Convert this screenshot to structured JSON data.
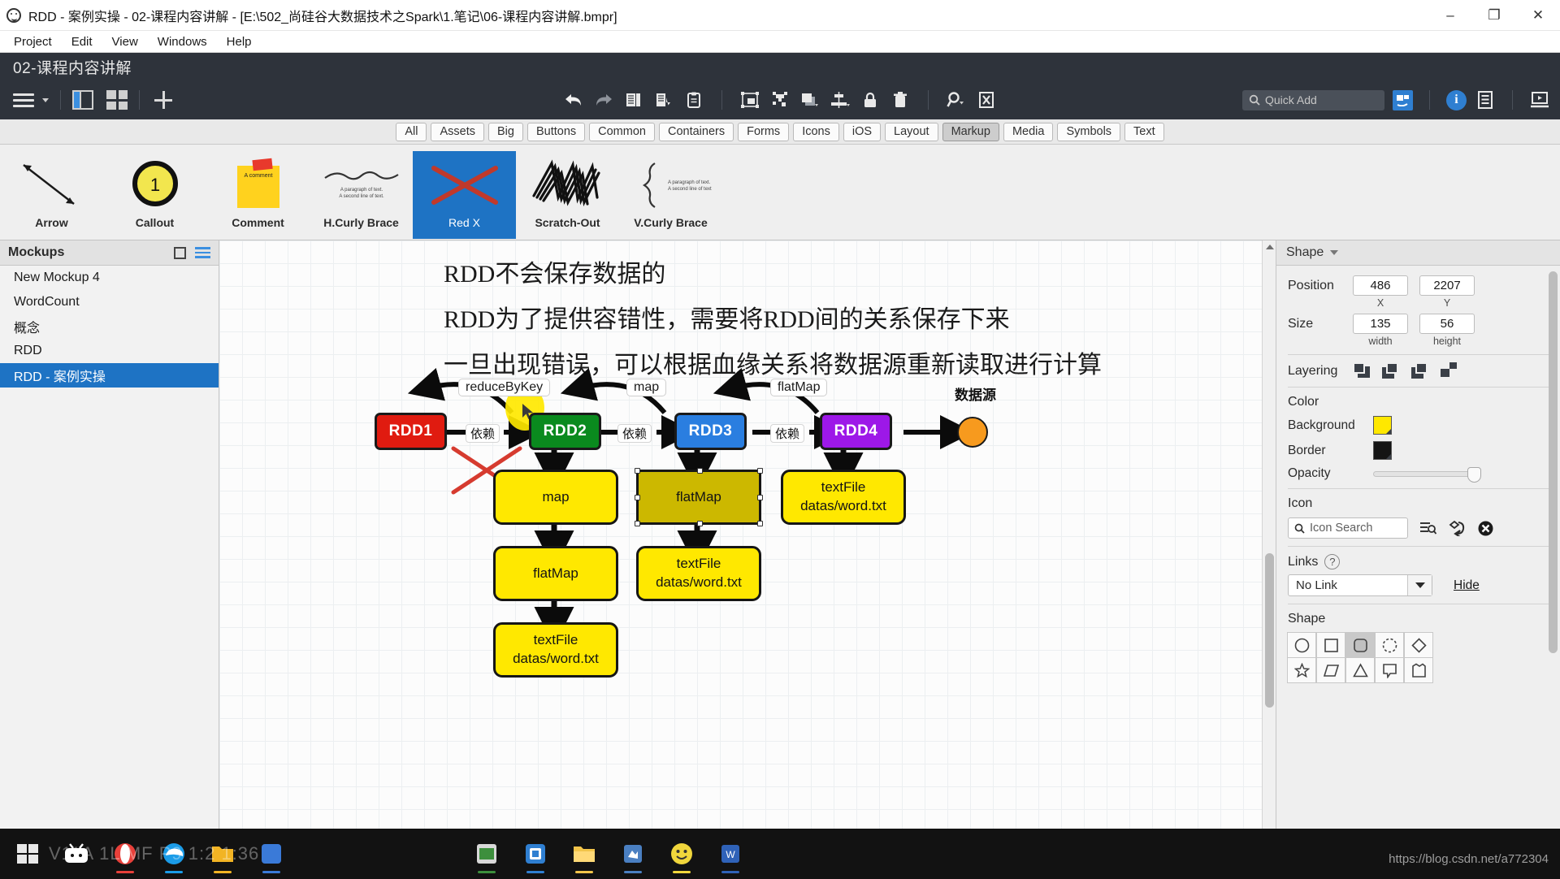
{
  "window": {
    "title": "RDD - 案例实操 - 02-课程内容讲解 - [E:\\502_尚硅谷大数据技术之Spark\\1.笔记\\06-课程内容讲解.bmpr]",
    "minimize": "–",
    "maximize": "❐",
    "close": "✕"
  },
  "menubar": {
    "items": [
      "Project",
      "Edit",
      "View",
      "Windows",
      "Help"
    ]
  },
  "header": {
    "document_name": "02-课程内容讲解"
  },
  "toolbar": {
    "left_icons": [
      "hamburger-menu",
      "panel-toggle",
      "grid-view",
      "add-new"
    ],
    "center_icons": [
      "undo",
      "redo",
      "duplicate",
      "import",
      "paste",
      "group",
      "ungroup",
      "shape-order",
      "align",
      "lock",
      "delete",
      "zoom",
      "fit-to-screen"
    ],
    "quick_add_placeholder": "Quick Add",
    "right_icons": [
      "presentation",
      "info",
      "notes",
      "play"
    ]
  },
  "category_tabs": {
    "items": [
      "All",
      "Assets",
      "Big",
      "Buttons",
      "Common",
      "Containers",
      "Forms",
      "Icons",
      "iOS",
      "Layout",
      "Markup",
      "Media",
      "Symbols",
      "Text"
    ],
    "active": "Markup"
  },
  "stencils": {
    "items": [
      {
        "label": "Arrow",
        "icon": "arrow-diagonal-icon",
        "selected": false
      },
      {
        "label": "Callout",
        "icon": "callout-numbered-icon",
        "selected": false
      },
      {
        "label": "Comment",
        "icon": "sticky-note-icon",
        "selected": false,
        "note_text": "A comment"
      },
      {
        "label": "H.Curly Brace",
        "icon": "horizontal-curly-brace-icon",
        "selected": false,
        "sample_text": "A paragraph of text.\nA second line of text."
      },
      {
        "label": "Red X",
        "icon": "red-x-icon",
        "selected": true
      },
      {
        "label": "Scratch-Out",
        "icon": "scratch-out-icon",
        "selected": false
      },
      {
        "label": "V.Curly Brace",
        "icon": "vertical-curly-brace-icon",
        "selected": false,
        "sample_text": "A paragraph of text.\nA second line of text."
      }
    ]
  },
  "left_panel": {
    "title": "Mockups",
    "header_icons": [
      "new-mockup-icon",
      "list-options-icon"
    ],
    "items": [
      {
        "label": "New Mockup 4",
        "active": false
      },
      {
        "label": "WordCount",
        "active": false
      },
      {
        "label": "概念",
        "active": false
      },
      {
        "label": "RDD",
        "active": false
      },
      {
        "label": "RDD - 案例实操",
        "active": true
      }
    ]
  },
  "canvas": {
    "text_lines": [
      "RDD不会保存数据的",
      "RDD为了提供容错性，需要将RDD间的关系保存下来",
      "一旦出现错误，可以根据血缘关系将数据源重新读取进行计算"
    ],
    "rdd_nodes": [
      {
        "label": "RDD1",
        "color": "#e01b10"
      },
      {
        "label": "RDD2",
        "color": "#0a8a1e"
      },
      {
        "label": "RDD3",
        "color": "#2a7ee0"
      },
      {
        "label": "RDD4",
        "color": "#9d18e8"
      }
    ],
    "dependency_labels": [
      "依赖",
      "依赖",
      "依赖"
    ],
    "operation_labels": [
      "reduceByKey",
      "map",
      "flatMap"
    ],
    "data_source_label": "数据源",
    "columns": [
      {
        "boxes": [
          "map",
          "flatMap",
          "textFile\ndatas/word.txt"
        ]
      },
      {
        "boxes": [
          "flatMap",
          "textFile\ndatas/word.txt"
        ],
        "selected_index": 0
      },
      {
        "boxes": [
          "textFile\ndatas/word.txt"
        ]
      }
    ],
    "box_texts": {
      "map": "map",
      "flatMap": "flatMap",
      "textFile_line1": "textFile",
      "textFile_line2": "datas/word.txt"
    }
  },
  "right_panel": {
    "title": "Shape",
    "position_label": "Position",
    "position_x": "486",
    "position_y": "2207",
    "position_x_sub": "X",
    "position_y_sub": "Y",
    "size_label": "Size",
    "size_width": "135",
    "size_height": "56",
    "size_width_sub": "width",
    "size_height_sub": "height",
    "layering_label": "Layering",
    "layering_icons": [
      "bring-to-front-icon",
      "bring-forward-icon",
      "send-backward-icon",
      "send-to-back-icon"
    ],
    "color_label": "Color",
    "background_label": "Background",
    "background_color": "#ffe800",
    "border_label": "Border",
    "border_color": "#141414",
    "opacity_label": "Opacity",
    "opacity_value": 100,
    "icon_label": "Icon",
    "icon_search_placeholder": "Icon Search",
    "icon_buttons": [
      "icon-list-search-icon",
      "icon-flip-icon",
      "icon-clear-icon"
    ],
    "links_label": "Links",
    "links_help": "?",
    "link_value": "No Link",
    "hide_label": "Hide",
    "shape_label": "Shape",
    "shape_options_row1": [
      "circle",
      "square",
      "rounded-rect",
      "dashed-circle",
      "diamond"
    ],
    "shape_options_row2": [
      "star",
      "parallelogram",
      "triangle",
      "speech-bubble",
      "banner"
    ],
    "shape_selected": "rounded-rect"
  },
  "taskbar": {
    "apps": [
      "windows-start",
      "bilibili",
      "opera",
      "edge",
      "folder",
      "app-5",
      "video-editor",
      "chrome",
      "explorer",
      "app-9",
      "emoji",
      "wps"
    ],
    "ghost_text": "V11A        1L  MF   P9    1:2    1:36",
    "watermark": "https://blog.csdn.net/a772304"
  }
}
